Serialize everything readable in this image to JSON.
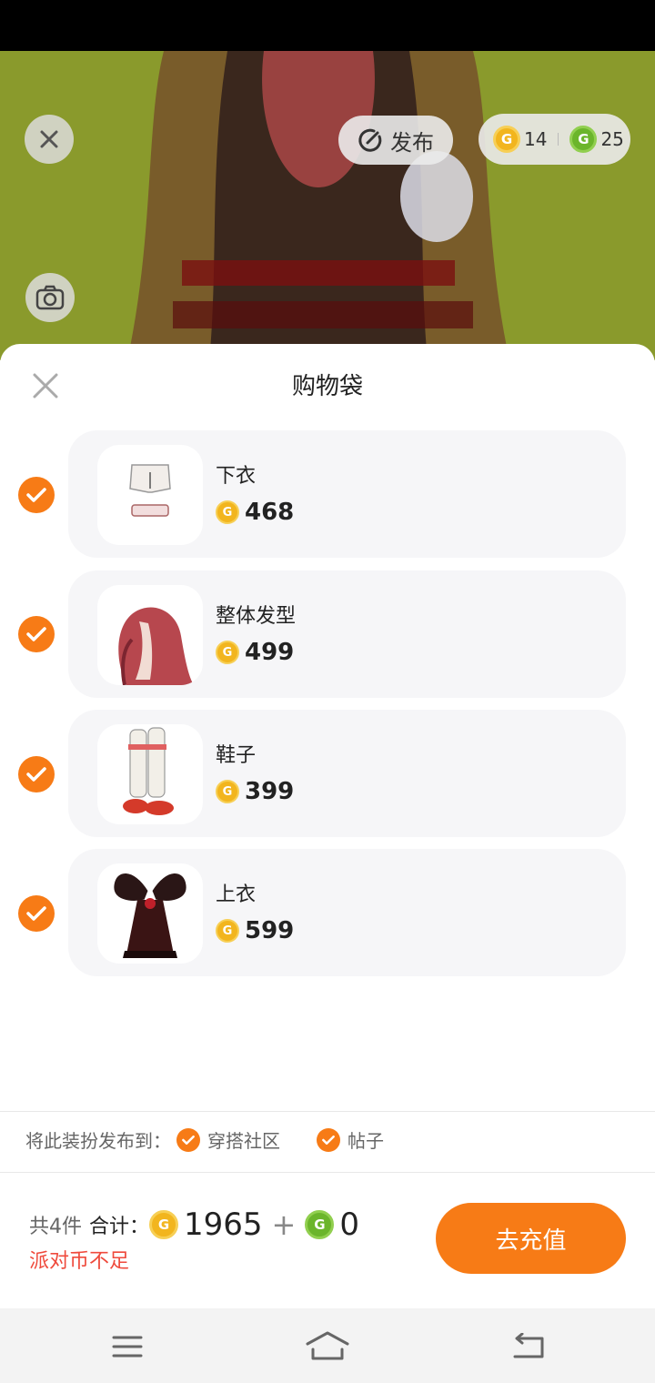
{
  "header": {
    "publish_label": "发布",
    "gold_balance": "14",
    "green_balance": "25"
  },
  "sheet": {
    "title": "购物袋",
    "items": [
      {
        "name": "下衣",
        "price": "468"
      },
      {
        "name": "整体发型",
        "price": "499"
      },
      {
        "name": "鞋子",
        "price": "399"
      },
      {
        "name": "上衣",
        "price": "599"
      }
    ]
  },
  "publish_to": {
    "label": "将此装扮发布到：",
    "options": [
      "穿搭社区",
      "帖子"
    ]
  },
  "footer": {
    "count_label": "共4件",
    "total_label": "合计：",
    "gold_total": "1965",
    "plus": "+",
    "green_total": "0",
    "warning": "派对币不足",
    "recharge_label": "去充值"
  },
  "icons": {
    "coin_glyph": "G"
  },
  "colors": {
    "accent": "#f77b16",
    "warning": "#ef4a3c",
    "gold_coin": "#f2b51e",
    "green_coin": "#6bb52b"
  }
}
